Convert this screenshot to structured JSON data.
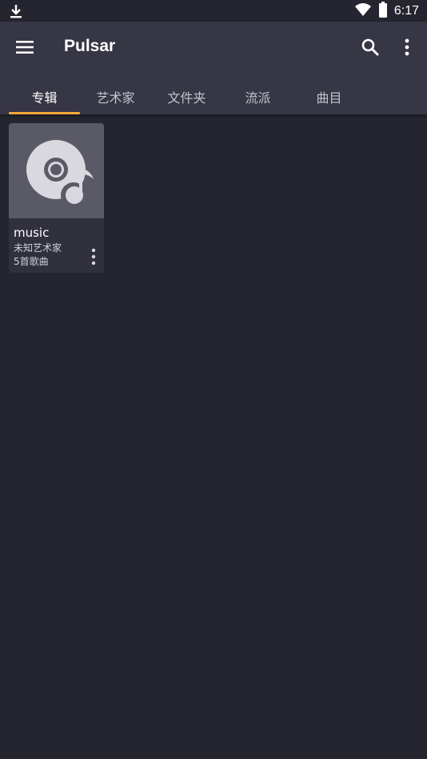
{
  "status_bar": {
    "download_icon": "download-icon",
    "wifi_icon": "wifi-icon",
    "battery_icon": "battery-icon",
    "time": "6:17"
  },
  "app_bar": {
    "menu_icon": "hamburger-menu-icon",
    "title": "Pulsar",
    "search_icon": "search-icon",
    "overflow_icon": "more-vert-icon"
  },
  "tabs": [
    {
      "label": "专辑",
      "active": true
    },
    {
      "label": "艺术家",
      "active": false
    },
    {
      "label": "文件夹",
      "active": false
    },
    {
      "label": "流派",
      "active": false
    },
    {
      "label": "曲目",
      "active": false
    }
  ],
  "albums": [
    {
      "title": "music",
      "artist": "未知艺术家",
      "song_count": "5首歌曲",
      "art_icon": "album-placeholder-icon",
      "menu_icon": "more-vert-icon"
    }
  ],
  "colors": {
    "background": "#25252f",
    "app_bar": "#363645",
    "accent": "#f2a93b",
    "card": "#31313e"
  }
}
